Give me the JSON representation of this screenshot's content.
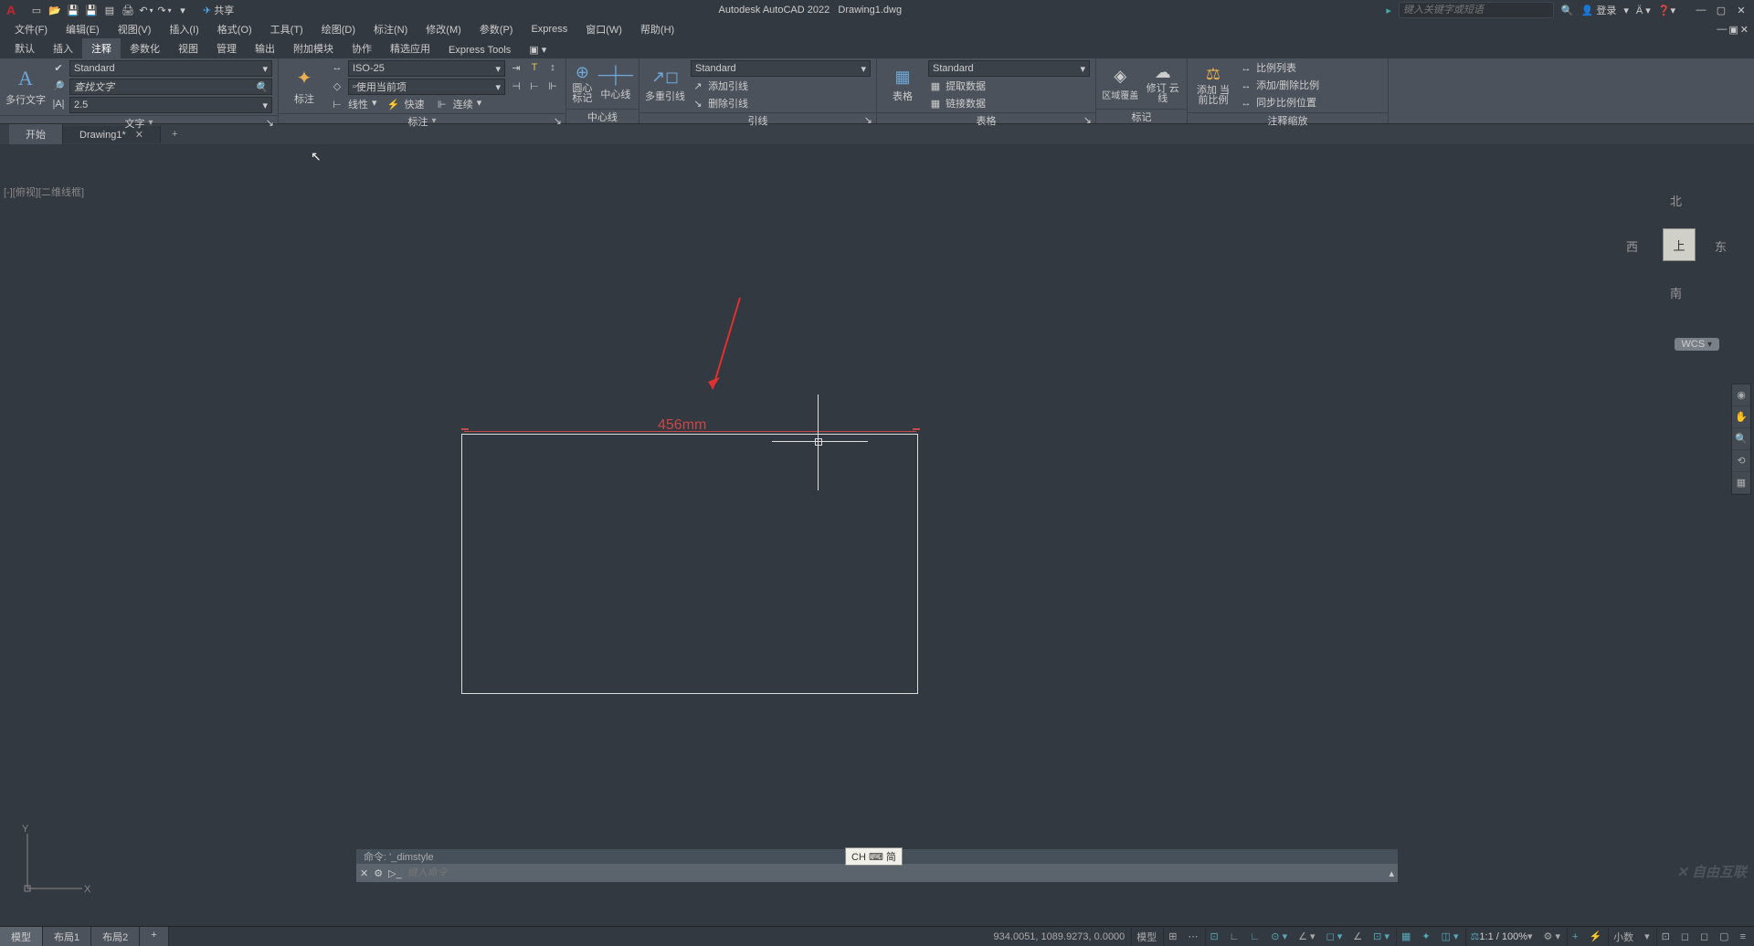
{
  "title": {
    "app": "Autodesk AutoCAD 2022",
    "doc": "Drawing1.dwg"
  },
  "qat_icons": [
    "new",
    "open",
    "save",
    "saveall",
    "plot",
    "print",
    "undo",
    "redo",
    "share"
  ],
  "share_label": "共享",
  "search_placeholder": "键入关键字或短语",
  "login_label": "登录",
  "menus": [
    "文件(F)",
    "编辑(E)",
    "视图(V)",
    "插入(I)",
    "格式(O)",
    "工具(T)",
    "绘图(D)",
    "标注(N)",
    "修改(M)",
    "参数(P)",
    "Express",
    "窗口(W)",
    "帮助(H)"
  ],
  "ribbon_tabs": [
    "默认",
    "插入",
    "注释",
    "参数化",
    "视图",
    "管理",
    "输出",
    "附加模块",
    "协作",
    "精选应用",
    "Express Tools"
  ],
  "active_ribbon_tab": "注释",
  "panels": {
    "text": {
      "big": "多行文字",
      "style": "Standard",
      "find": "查找文字",
      "height": "2.5",
      "label": "文字"
    },
    "dim": {
      "big": "标注",
      "style": "ISO-25",
      "use_current": "使用当前项",
      "linear": "线性",
      "quick": "快速",
      "continue": "连续",
      "label": "标注"
    },
    "center": {
      "c1": "圆心\n标记",
      "c2": "中心线",
      "label": "中心线"
    },
    "leader": {
      "big": "多重引线",
      "style": "Standard",
      "add": "添加引线",
      "del": "删除引线",
      "label": "引线"
    },
    "table": {
      "big": "表格",
      "style": "Standard",
      "extract": "提取数据",
      "link": "链接数据",
      "label": "表格"
    },
    "markup": {
      "wipe": "区域覆盖",
      "rev": "修订\n云线",
      "label": "标记"
    },
    "scale": {
      "add": "添加\n当前比例",
      "list": "比例列表",
      "adddel": "添加/删除比例",
      "sync": "同步比例位置",
      "label": "注释缩放"
    }
  },
  "filetabs": {
    "start": "开始",
    "drawing": "Drawing1*"
  },
  "viewport_label": "[-][俯视][二维线框]",
  "dimension_value": "456mm",
  "viewcube": {
    "n": "北",
    "s": "南",
    "e": "东",
    "w": "西",
    "top": "上",
    "wcs": "WCS"
  },
  "ucs": {
    "x": "X",
    "y": "Y"
  },
  "cmd": {
    "history": "命令: '_dimstyle",
    "placeholder": "键入命令",
    "close": "✕"
  },
  "ime": "CH ⌨ 简",
  "model_tabs": {
    "model": "模型",
    "l1": "布局1",
    "l2": "布局2",
    "add": "+"
  },
  "status": {
    "coords": "934.0051, 1089.9273, 0.0000",
    "model": "模型",
    "scale": "1:1 / 100%",
    "decimal": "小数"
  },
  "watermark": "✕ 自由互联"
}
